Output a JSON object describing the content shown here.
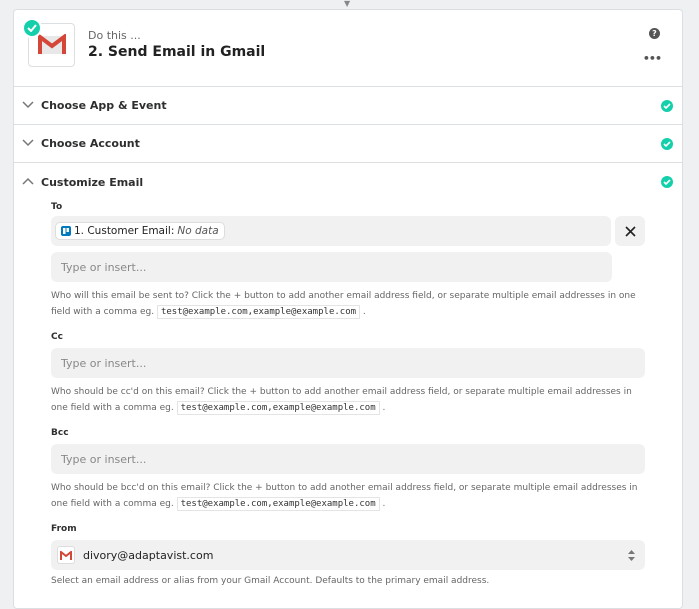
{
  "header": {
    "kicker": "Do this ...",
    "title": "2. Send Email in Gmail"
  },
  "sections": [
    {
      "label": "Choose App & Event"
    },
    {
      "label": "Choose Account"
    },
    {
      "label": "Customize Email"
    }
  ],
  "fields": {
    "to": {
      "label": "To",
      "pill_label": "1. Customer Email:",
      "pill_value": "No data",
      "placeholder": "Type or insert...",
      "hint": "Who will this email be sent to? Click the + button to add another email address field, or separate multiple email addresses in one field with a comma eg.",
      "example": "test@example.com,example@example.com"
    },
    "cc": {
      "label": "Cc",
      "placeholder": "Type or insert...",
      "hint": "Who should be cc'd on this email? Click the + button to add another email address field, or separate multiple email addresses in one field with a comma eg.",
      "example": "test@example.com,example@example.com"
    },
    "bcc": {
      "label": "Bcc",
      "placeholder": "Type or insert...",
      "hint": "Who should be bcc'd on this email? Click the + button to add another email address field, or separate multiple email addresses in one field with a comma eg.",
      "example": "test@example.com,example@example.com"
    },
    "from": {
      "label": "From",
      "value": "divory@adaptavist.com",
      "hint": "Select an email address or alias from your Gmail Account. Defaults to the primary email address."
    }
  },
  "punct": ".",
  "colors": {
    "success": "#13d0ab",
    "gmail_red": "#d44638"
  }
}
